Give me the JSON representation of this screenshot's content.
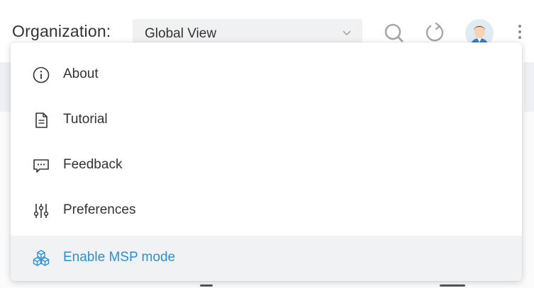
{
  "header": {
    "org_label": "Organization:",
    "org_select_value": "Global View",
    "icons": {
      "search": "search-icon",
      "refresh": "refresh-icon",
      "avatar": "user-avatar",
      "more": "more-vertical-icon"
    }
  },
  "menu": {
    "items": [
      {
        "label": "About",
        "icon": "info-circle-icon"
      },
      {
        "label": "Tutorial",
        "icon": "document-icon"
      },
      {
        "label": "Feedback",
        "icon": "chat-bubble-icon"
      },
      {
        "label": "Preferences",
        "icon": "sliders-icon"
      },
      {
        "label": "Enable MSP mode",
        "icon": "cubes-icon",
        "highlighted": true
      }
    ]
  },
  "colors": {
    "accent": "#2a8fd8",
    "text": "#333333",
    "hover_bg": "#f1f2f4",
    "select_bg": "#f0f1f3"
  }
}
